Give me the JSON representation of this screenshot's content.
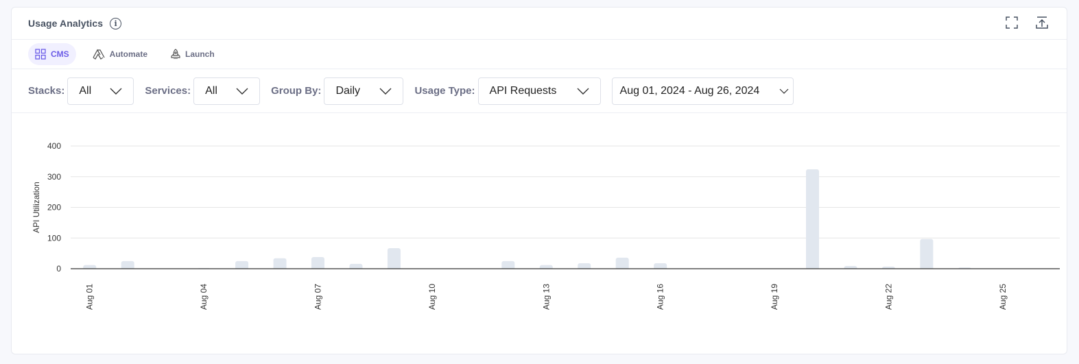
{
  "header": {
    "title": "Usage Analytics",
    "info_icon": "info-icon",
    "fullscreen_icon": "fullscreen-icon",
    "export_icon": "export-icon"
  },
  "tabs": [
    {
      "label": "CMS",
      "icon": "grid-icon",
      "active": true
    },
    {
      "label": "Automate",
      "icon": "automate-icon"
    },
    {
      "label": "Launch",
      "icon": "rocket-icon"
    }
  ],
  "filters": {
    "stacks": {
      "label": "Stacks:",
      "value": "All"
    },
    "services": {
      "label": "Services:",
      "value": "All"
    },
    "group_by": {
      "label": "Group By:",
      "value": "Daily"
    },
    "usage_type": {
      "label": "Usage Type:",
      "value": "API Requests"
    },
    "date_range": {
      "value": "Aug 01, 2024 - Aug 26, 2024"
    }
  },
  "colors": {
    "accent": "#6c5ce7",
    "bar": "#e1e7ef",
    "grid": "#e5e5e5"
  },
  "chart_data": {
    "type": "bar",
    "title": "",
    "xlabel": "",
    "ylabel": "API Utilization",
    "ylim": [
      0,
      400
    ],
    "yticks": [
      0,
      100,
      200,
      300,
      400
    ],
    "grid": true,
    "categories": [
      "Aug 01",
      "Aug 02",
      "Aug 03",
      "Aug 04",
      "Aug 05",
      "Aug 06",
      "Aug 07",
      "Aug 08",
      "Aug 09",
      "Aug 10",
      "Aug 11",
      "Aug 12",
      "Aug 13",
      "Aug 14",
      "Aug 15",
      "Aug 16",
      "Aug 17",
      "Aug 18",
      "Aug 19",
      "Aug 20",
      "Aug 21",
      "Aug 22",
      "Aug 23",
      "Aug 24",
      "Aug 25",
      "Aug 26"
    ],
    "tick_labels": [
      "Aug 01",
      "Aug 04",
      "Aug 07",
      "Aug 10",
      "Aug 13",
      "Aug 16",
      "Aug 19",
      "Aug 22",
      "Aug 25"
    ],
    "values": [
      12,
      25,
      0,
      2,
      25,
      34,
      38,
      16,
      67,
      0,
      0,
      25,
      12,
      18,
      36,
      18,
      0,
      0,
      0,
      324,
      9,
      7,
      97,
      4,
      0,
      0
    ]
  }
}
